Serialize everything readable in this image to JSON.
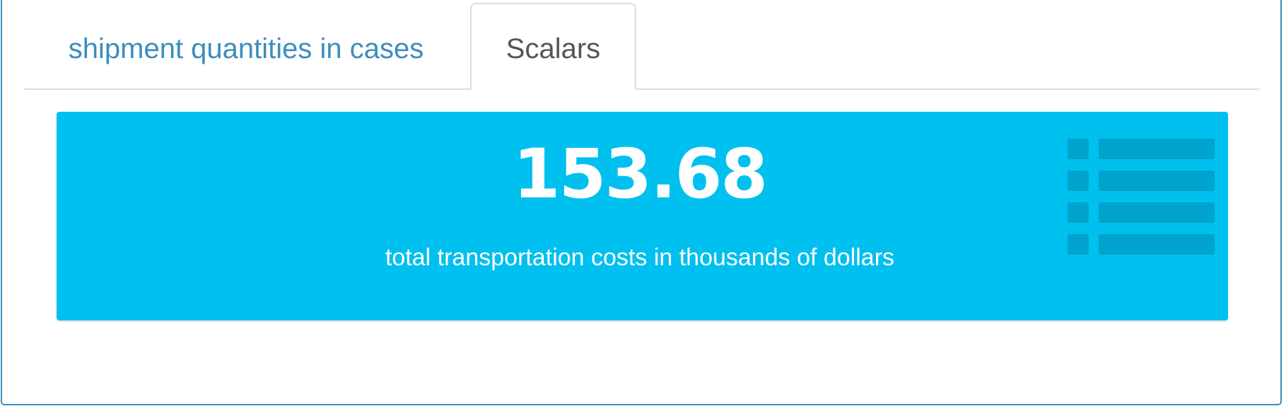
{
  "tabs": [
    {
      "label": "shipment quantities in cases",
      "active": false
    },
    {
      "label": "Scalars",
      "active": true
    }
  ],
  "value_box": {
    "value": "153.68",
    "caption": "total transportation costs in thousands of dollars",
    "icon": "list-icon",
    "background_color": "#00c0ef"
  },
  "colors": {
    "panel_border": "#3c8dbc",
    "tab_link": "#3c8dbc",
    "tab_active_text": "#555555"
  }
}
